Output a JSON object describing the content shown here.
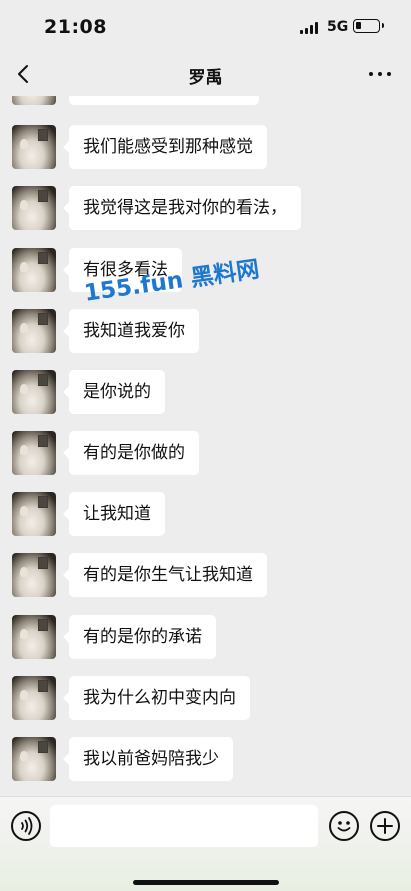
{
  "status_bar": {
    "time": "21:08",
    "network": "5G",
    "battery_level": 0.25
  },
  "nav": {
    "title": "罗禹",
    "back_icon": "chevron-left-icon",
    "more_icon": "ellipsis-icon"
  },
  "messages": [
    {
      "text": "我们能感受到那种感觉"
    },
    {
      "text": "我觉得这是我对你的看法，"
    },
    {
      "text": "有很多看法"
    },
    {
      "text": "我知道我爱你"
    },
    {
      "text": "是你说的"
    },
    {
      "text": "有的是你做的"
    },
    {
      "text": "让我知道"
    },
    {
      "text": "有的是你生气让我知道"
    },
    {
      "text": "有的是你的承诺"
    },
    {
      "text": "我为什么初中变内向"
    },
    {
      "text": "我以前爸妈陪我少"
    }
  ],
  "watermark": "155.fun 黑料网",
  "input_bar": {
    "value": "",
    "voice_icon": "voice-icon",
    "emoji_icon": "emoji-icon",
    "plus_icon": "plus-icon"
  },
  "colors": {
    "background": "#ededed",
    "bubble": "#ffffff",
    "watermark": "#1e78d0"
  }
}
